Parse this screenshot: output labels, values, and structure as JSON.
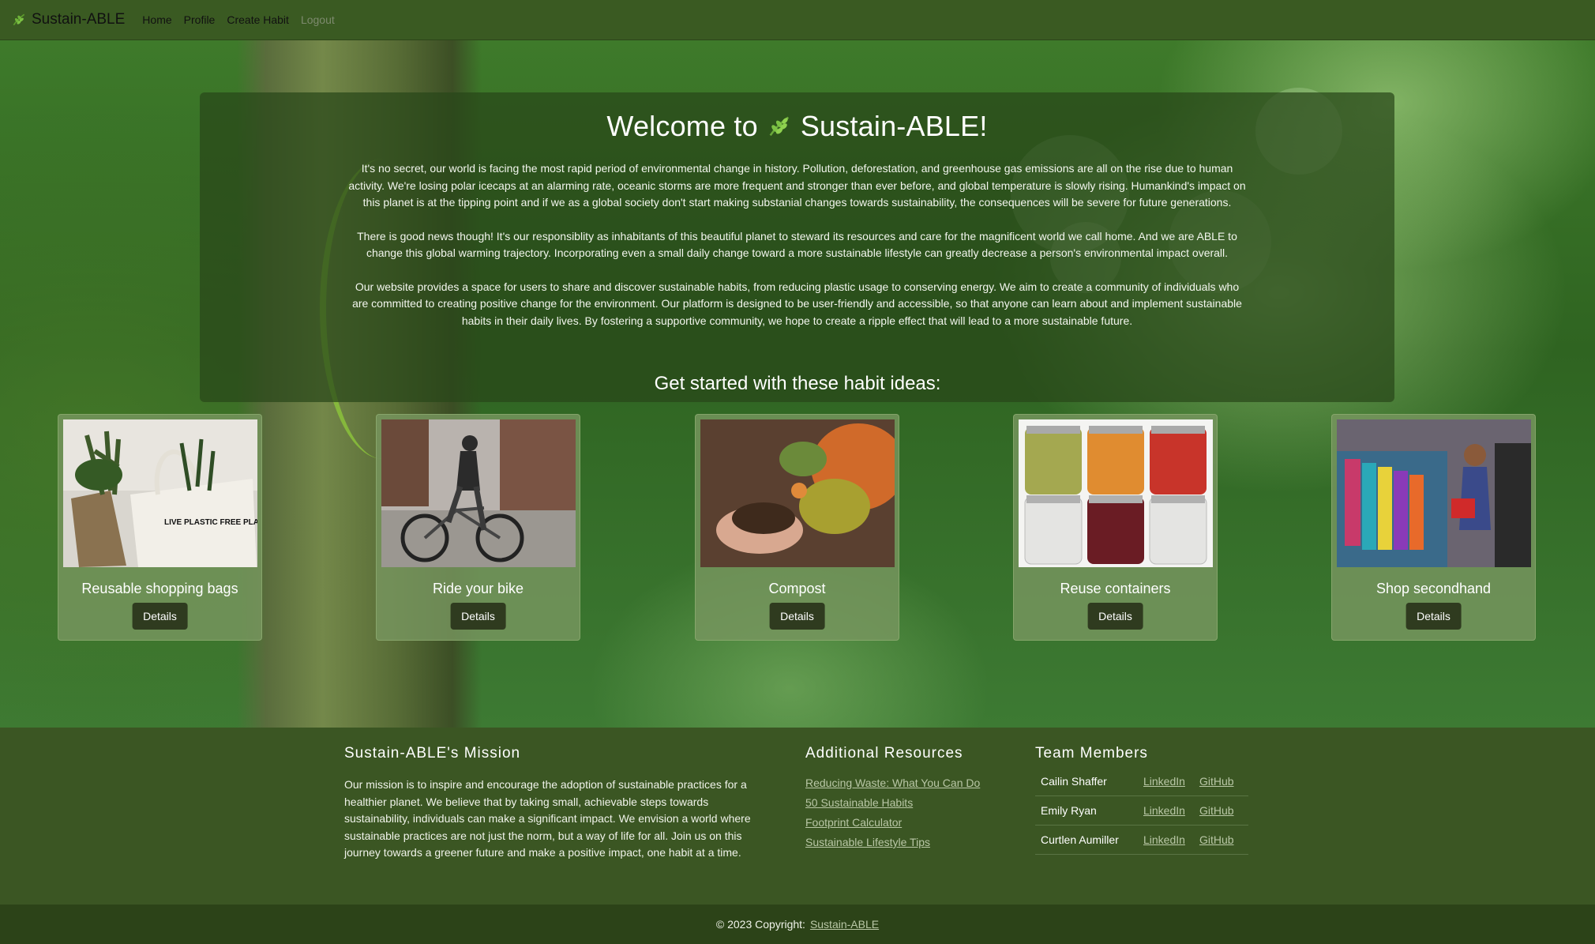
{
  "navbar": {
    "brand": "Sustain-ABLE",
    "links": [
      "Home",
      "Profile",
      "Create Habit",
      "Logout"
    ]
  },
  "intro": {
    "title_prefix": "Welcome to",
    "title_suffix": "Sustain-ABLE!",
    "paragraphs": [
      "It's no secret, our world is facing the most rapid period of environmental change in history. Pollution, deforestation, and greenhouse gas emissions are all on the rise due to human activity. We're losing polar icecaps at an alarming rate, oceanic storms are more frequent and stronger than ever before, and global temperature is slowly rising. Humankind's impact on this planet is at the tipping point and if we as a global society don't start making substanial changes towards sustainability, the consequences will be severe for future generations.",
      "There is good news though! It's our responsiblity as inhabitants of this beautiful planet to steward its resources and care for the magnificent world we call home. And we are ABLE to change this global warming trajectory. Incorporating even a small daily change toward a more sustainable lifestyle can greatly decrease a person's environmental impact overall.",
      "Our website provides a space for users to share and discover sustainable habits, from reducing plastic usage to conserving energy. We aim to create a community of individuals who are committed to creating positive change for the environment. Our platform is designed to be user-friendly and accessible, so that anyone can learn about and implement sustainable habits in their daily lives. By fostering a supportive community, we hope to create a ripple effect that will lead to a more sustainable future."
    ]
  },
  "habits_title": "Get started with these habit ideas:",
  "habits": [
    {
      "title": "Reusable shopping bags",
      "button": "Details",
      "bag_text": "LIVE PLASTIC FREE PLASTIC IS POISON PLASTIC IS PERMANENT REFUSE PLASTIC"
    },
    {
      "title": "Ride your bike",
      "button": "Details"
    },
    {
      "title": "Compost",
      "button": "Details"
    },
    {
      "title": "Reuse containers",
      "button": "Details"
    },
    {
      "title": "Shop secondhand",
      "button": "Details"
    }
  ],
  "footer": {
    "mission_title": "Sustain-ABLE's Mission",
    "mission_text": "Our mission is to inspire and encourage the adoption of sustainable practices for a healthier planet. We believe that by taking small, achievable steps towards sustainability, individuals can make a significant impact. We envision a world where sustainable practices are not just the norm, but a way of life for all. Join us on this journey towards a greener future and make a positive impact, one habit at a time.",
    "resources_title": "Additional Resources",
    "resources": [
      "Reducing Waste: What You Can Do",
      "50 Sustainable Habits",
      "Footprint Calculator",
      "Sustainable Lifestyle Tips"
    ],
    "team_title": "Team Members",
    "team": [
      {
        "name": "Cailin Shaffer",
        "linkedin": "LinkedIn",
        "github": "GitHub"
      },
      {
        "name": "Emily Ryan",
        "linkedin": "LinkedIn",
        "github": "GitHub"
      },
      {
        "name": "Curtlen Aumiller",
        "linkedin": "LinkedIn",
        "github": "GitHub"
      }
    ]
  },
  "copyright": {
    "text": "© 2023 Copyright:",
    "link": "Sustain-ABLE"
  },
  "colors": {
    "navbar": "#3a5a22",
    "footer": "#3b5623",
    "copyright_bar": "#2c4318",
    "button": "#2f3b1f",
    "card": "#78965f"
  }
}
